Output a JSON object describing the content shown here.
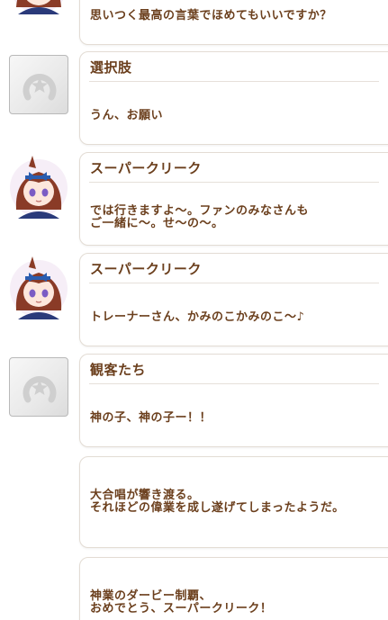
{
  "entries": [
    {
      "type": "dialogue",
      "speaker": "",
      "avatar": "none",
      "text": "思いつく最高の言葉でほめてもいいですか？"
    },
    {
      "type": "choice",
      "speaker": "選択肢",
      "avatar": "placeholder-avatar-icon",
      "text": "うん、お願い"
    },
    {
      "type": "dialogue",
      "speaker": "スーパークリーク",
      "avatar": "character-portrait",
      "text": "では行きますよ～。ファンのみなさんも\nご一緒に～。せ～の～。"
    },
    {
      "type": "dialogue",
      "speaker": "スーパークリーク",
      "avatar": "character-portrait",
      "text": "トレーナーさん、かみのこかみのこ～♪"
    },
    {
      "type": "dialogue",
      "speaker": "観客たち",
      "avatar": "placeholder-avatar-icon",
      "text": "神の子、神の子ー！！"
    },
    {
      "type": "narration",
      "speaker": "",
      "avatar": "none",
      "text": "大合唱が響き渡る。\nそれほどの偉業を成し遂げてしまったようだ。"
    },
    {
      "type": "narration",
      "speaker": "",
      "avatar": "none",
      "text": "神業のダービー制覇、\nおめでとう、スーパークリーク！"
    }
  ],
  "colors": {
    "text": "#6b3f1d",
    "border": "#e3dcd4",
    "hair": "#8a3b27",
    "ribbon": "#2a5db0",
    "eye": "#7b5cc4"
  }
}
